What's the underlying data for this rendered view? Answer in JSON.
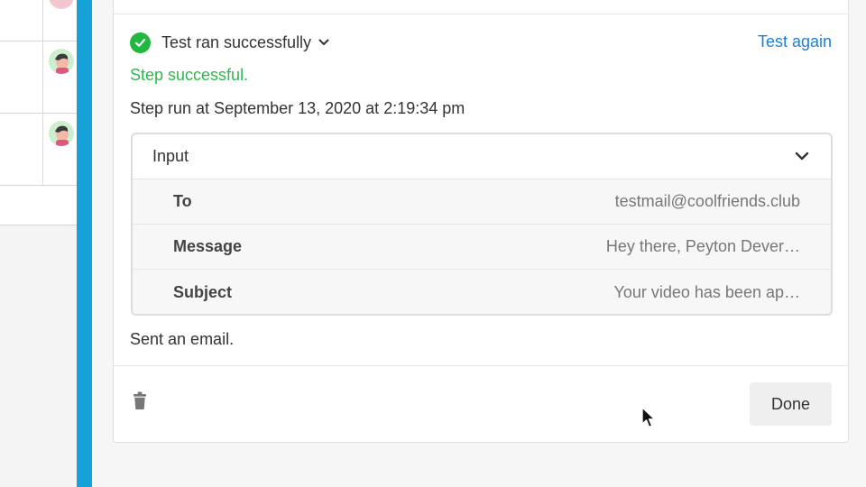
{
  "status": {
    "text": "Test ran successfully",
    "test_again_label": "Test again",
    "step_result": "Step successful.",
    "run_time": "Step run at September 13, 2020 at 2:19:34 pm"
  },
  "input": {
    "title": "Input",
    "rows": [
      {
        "label": "To",
        "value": "testmail@coolfriends.club"
      },
      {
        "label": "Message",
        "value": "Hey there, Peyton Dever…"
      },
      {
        "label": "Subject",
        "value": "Your video has been ap…"
      }
    ]
  },
  "summary": "Sent an email.",
  "footer": {
    "done_label": "Done"
  },
  "colors": {
    "success": "#20b83f",
    "link": "#1d7fd6",
    "sidebar_accent": "#17a1d9"
  },
  "icons": [
    "check-circle-icon",
    "chevron-down-icon",
    "trash-icon",
    "avatar",
    "mouse-cursor-icon"
  ]
}
